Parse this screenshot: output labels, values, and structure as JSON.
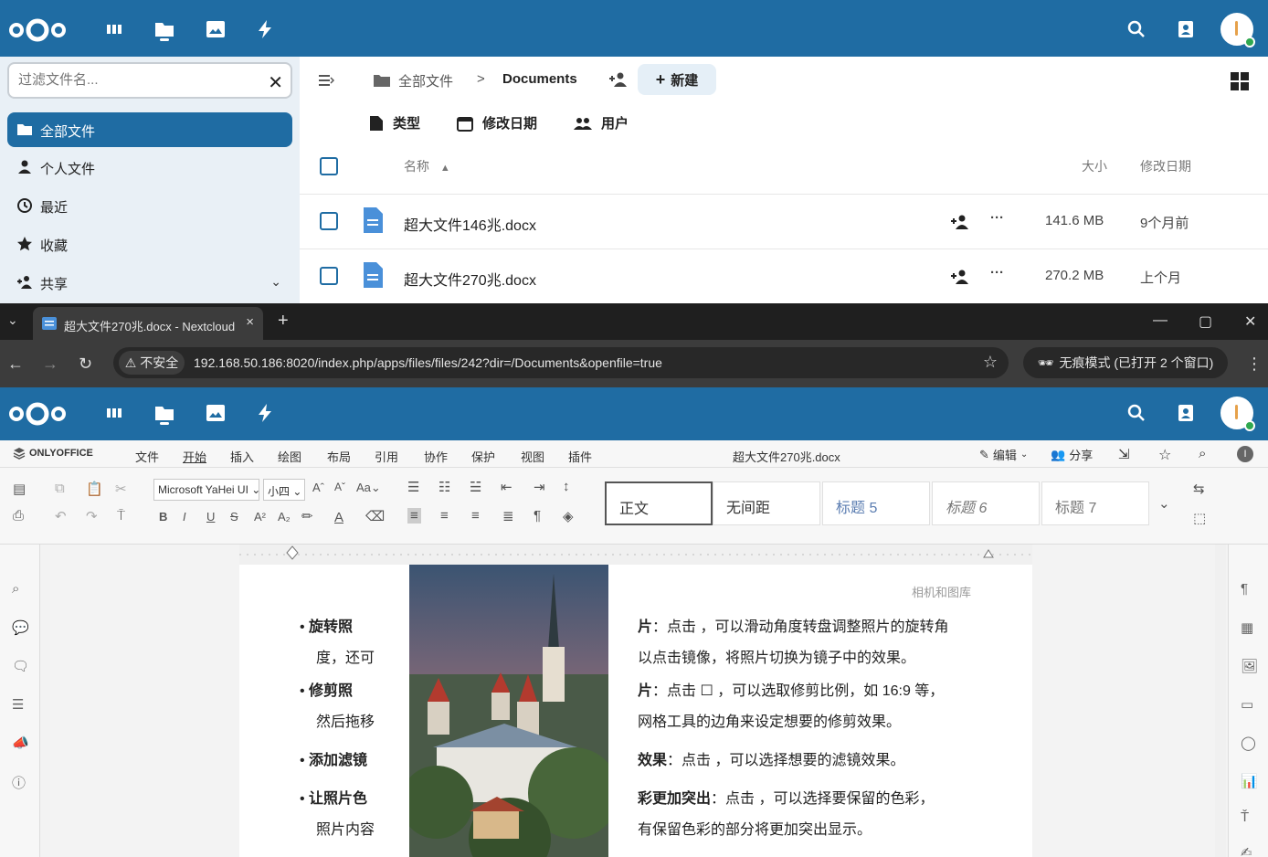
{
  "top": {
    "filter_placeholder": "过滤文件名...",
    "nav": [
      {
        "label": "全部文件",
        "icon": "folder-icon",
        "active": true
      },
      {
        "label": "个人文件",
        "icon": "person-icon",
        "active": false
      },
      {
        "label": "最近",
        "icon": "clock-icon",
        "active": false
      },
      {
        "label": "收藏",
        "icon": "star-icon",
        "active": false
      },
      {
        "label": "共享",
        "icon": "share-icon",
        "active": false
      }
    ],
    "breadcrumb_root": "全部文件",
    "breadcrumb_sep": ">",
    "breadcrumb_current": "Documents",
    "new_label": "新建",
    "filters": {
      "type": "类型",
      "modified": "修改日期",
      "people": "用户"
    },
    "columns": {
      "name": "名称",
      "size": "大小",
      "modified": "修改日期"
    },
    "files": [
      {
        "name": "超大文件146兆.docx",
        "size": "141.6 MB",
        "modified": "9个月前",
        "more": "···"
      },
      {
        "name": "超大文件270兆.docx",
        "size": "270.2 MB",
        "modified": "上个月",
        "more": "···"
      }
    ]
  },
  "browser": {
    "tab_title": "超大文件270兆.docx - Nextcloud",
    "tab_close": "×",
    "tab_new": "+",
    "insecure_label": "不安全",
    "url": "192.168.50.186:8020/index.php/apps/files/files/242?dir=/Documents&openfile=true",
    "incognito_label": "无痕模式 (已打开 2 个窗口)"
  },
  "editor": {
    "brand": "ONLYOFFICE",
    "tabs": [
      "文件",
      "开始",
      "插入",
      "绘图",
      "布局",
      "引用",
      "协作",
      "保护",
      "视图",
      "插件"
    ],
    "active_tab": "开始",
    "doc_title": "超大文件270兆.docx",
    "edit_label": "编辑",
    "share_label": "分享",
    "font_name": "Microsoft YaHei UI",
    "font_size": "小四",
    "styles": [
      "正文",
      "无间距",
      "标题 5",
      "标题 6",
      "标题 7"
    ],
    "page_header": "相机和图库",
    "bullets": [
      {
        "bold": "旋转照",
        "rest": "度，还可"
      },
      {
        "bold": "修剪照",
        "rest": "然后拖移"
      },
      {
        "bold": "添加滤镜",
        "rest": ""
      },
      {
        "bold": "让照片色",
        "rest": "照片内容"
      }
    ],
    "paragraphs": [
      {
        "bold": "片",
        "text": "：点击 ，可以滑动角度转盘调整照片的旋转角"
      },
      {
        "bold": "",
        "text": "以点击镜像，将照片切换为镜子中的效果。"
      },
      {
        "bold": "片",
        "text": "：点击 ☐ ，可以选取修剪比例，如 16:9 等，"
      },
      {
        "bold": "",
        "text": "网格工具的边角来设定想要的修剪效果。"
      },
      {
        "bold": "效果",
        "text": "：点击 ，可以选择想要的滤镜效果。"
      },
      {
        "bold": "彩更加突出",
        "text": "：点击 ，可以选择要保留的色彩，"
      },
      {
        "bold": "",
        "text": "有保留色彩的部分将更加突出显示。"
      }
    ]
  },
  "colors": {
    "nc_blue": "#1f6ca3",
    "sidebar_bg": "#e9f0f6",
    "chrome_dark": "#1f1f1f"
  }
}
